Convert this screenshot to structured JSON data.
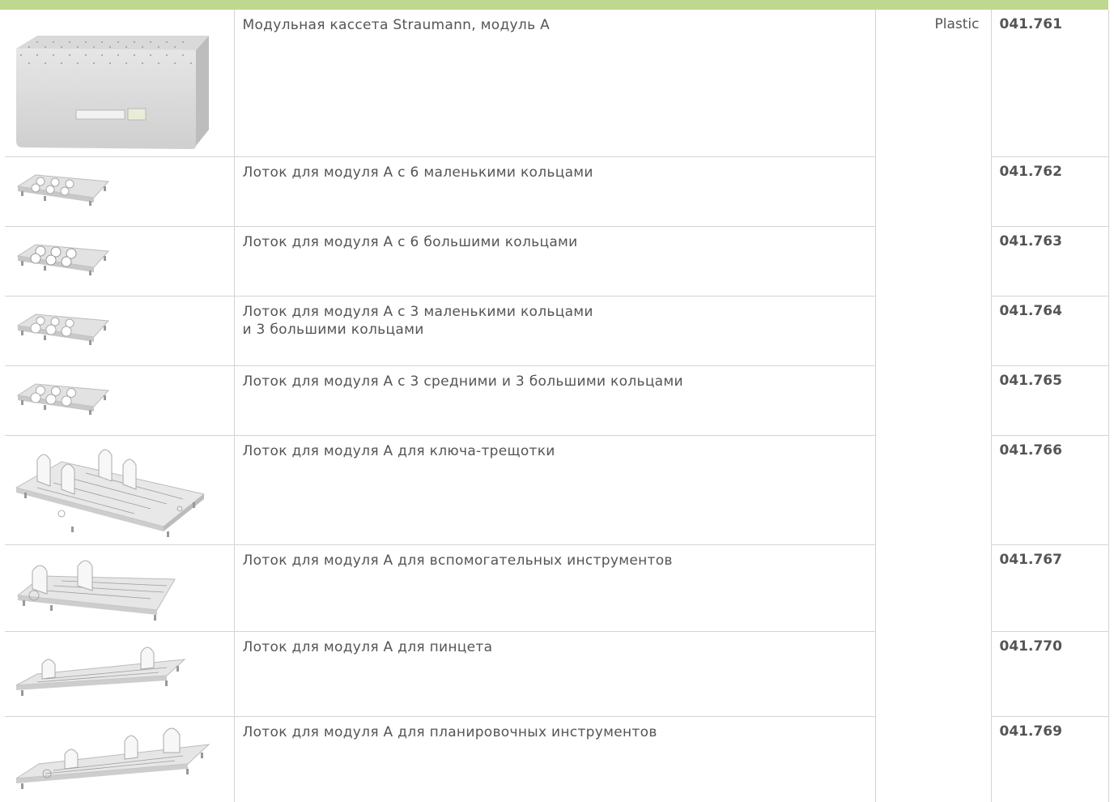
{
  "material": "Plastic",
  "rows": [
    {
      "lines": [
        "Модульная кассета Straumann, модуль А"
      ],
      "number": "041.761",
      "image": "modular-cassette-image"
    },
    {
      "lines": [
        "Лоток для модуля А с 6 маленькими кольцами"
      ],
      "number": "041.762",
      "image": "tray-small-rings-image"
    },
    {
      "lines": [
        "Лоток для модуля А с 6 большими кольцами"
      ],
      "number": "041.763",
      "image": "tray-large-rings-image"
    },
    {
      "lines": [
        "Лоток для модуля А с 3 маленькими кольцами",
        "и 3 большими кольцами"
      ],
      "number": "041.764",
      "image": "tray-mixed-rings-image"
    },
    {
      "lines": [
        "Лоток для модуля А с 3 средними и 3 большими кольцами"
      ],
      "number": "041.765",
      "image": "tray-medium-large-rings-image"
    },
    {
      "lines": [
        "Лоток для модуля А для ключа-трещотки"
      ],
      "number": "041.766",
      "image": "tray-ratchet-image"
    },
    {
      "lines": [
        "Лоток для модуля А для вспомогательных инструментов"
      ],
      "number": "041.767",
      "image": "tray-auxiliary-instruments-image"
    },
    {
      "lines": [
        "Лоток для модуля А для пинцета"
      ],
      "number": "041.770",
      "image": "tray-tweezers-image"
    },
    {
      "lines": [
        "Лоток для модуля А для планировочных инструментов"
      ],
      "number": "041.769",
      "image": "tray-planning-instruments-image"
    }
  ]
}
